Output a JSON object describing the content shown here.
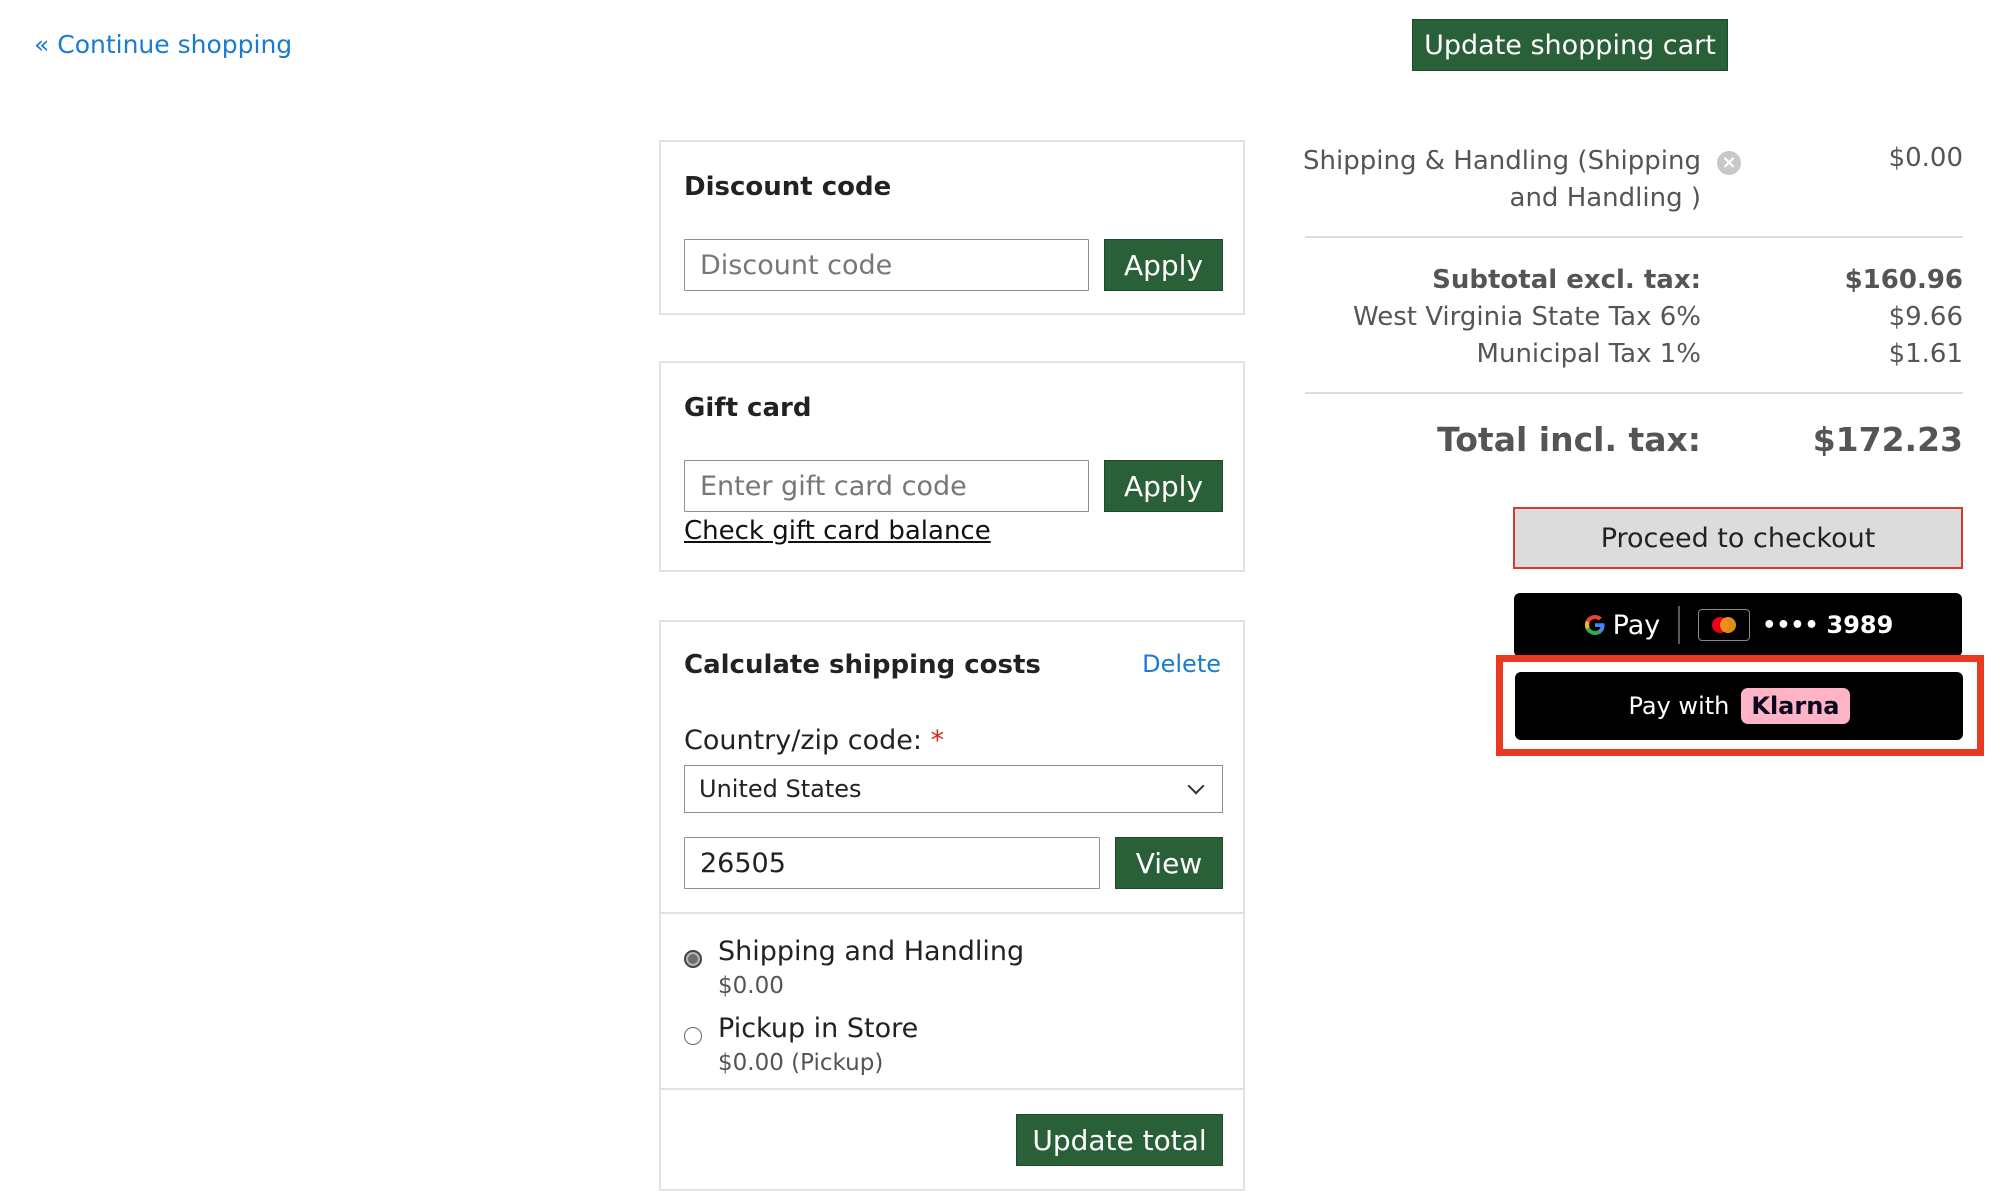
{
  "header": {
    "continue_shopping": "« Continue shopping",
    "update_cart_label": "Update shopping cart"
  },
  "discount": {
    "title": "Discount code",
    "placeholder": "Discount code",
    "apply_label": "Apply"
  },
  "giftcard": {
    "title": "Gift card",
    "placeholder": "Enter gift card code",
    "apply_label": "Apply",
    "check_balance_link": "Check gift card balance"
  },
  "shipping": {
    "title": "Calculate shipping costs",
    "delete_link": "Delete",
    "country_label": "Country/zip code:",
    "required_mark": "*",
    "country_value": "United States",
    "zip_value": "26505",
    "view_label": "View",
    "options": [
      {
        "name": "Shipping and Handling",
        "price": "$0.00",
        "selected": true
      },
      {
        "name": "Pickup in Store",
        "price": "$0.00 (Pickup)",
        "selected": false
      }
    ],
    "update_total_label": "Update total"
  },
  "summary": {
    "shipping_line1": "Shipping & Handling (Shipping",
    "shipping_line2": "and Handling )",
    "shipping_value": "$0.00",
    "remove_icon": "×",
    "subtotal_label": "Subtotal excl. tax:",
    "subtotal_value": "$160.96",
    "state_tax_label": "West Virginia State Tax 6%",
    "state_tax_value": "$9.66",
    "municipal_tax_label": "Municipal Tax 1%",
    "municipal_tax_value": "$1.61",
    "total_label": "Total incl. tax:",
    "total_value": "$172.23"
  },
  "payment": {
    "checkout_label": "Proceed to checkout",
    "gpay_label": "Pay",
    "card_dots": "••••",
    "card_last4": "3989",
    "klarna_prefix": "Pay with",
    "klarna_brand": "Klarna"
  },
  "colors": {
    "accent_green": "#2a6038",
    "link_blue": "#1a7bd1",
    "highlight_red": "#e83a21",
    "klarna_pink": "#ffb3c7"
  }
}
